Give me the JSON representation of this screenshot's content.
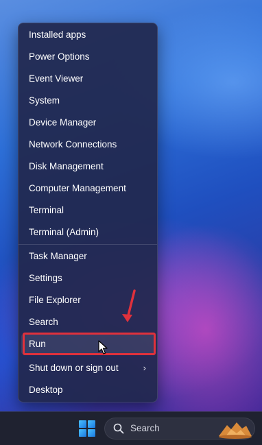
{
  "menu": {
    "items": [
      {
        "label": "Installed apps"
      },
      {
        "label": "Power Options"
      },
      {
        "label": "Event Viewer"
      },
      {
        "label": "System"
      },
      {
        "label": "Device Manager"
      },
      {
        "label": "Network Connections"
      },
      {
        "label": "Disk Management"
      },
      {
        "label": "Computer Management"
      },
      {
        "label": "Terminal"
      },
      {
        "label": "Terminal (Admin)"
      },
      {
        "label": "Task Manager"
      },
      {
        "label": "Settings"
      },
      {
        "label": "File Explorer"
      },
      {
        "label": "Search"
      },
      {
        "label": "Run",
        "highlighted": true
      },
      {
        "label": "Shut down or sign out",
        "has_submenu": true
      },
      {
        "label": "Desktop"
      }
    ]
  },
  "taskbar": {
    "search_label": "Search"
  },
  "icons": {
    "start": "windows-logo-icon",
    "search": "magnifier-icon",
    "submenu": "chevron-right-icon",
    "cursor": "mouse-pointer-icon",
    "annotation": "red-arrow-icon"
  },
  "colors": {
    "highlight_border": "#e0313c",
    "menu_background": "#21284e",
    "taskbar_background": "#1f2230"
  }
}
